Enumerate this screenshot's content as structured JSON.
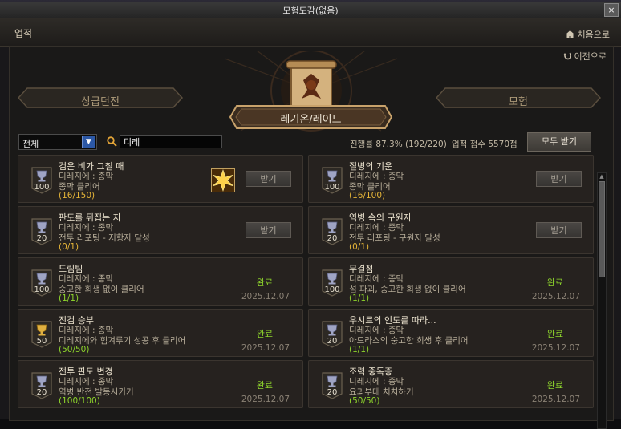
{
  "window": {
    "title": "모험도감(없음)",
    "close": "×"
  },
  "header": {
    "title": "업적",
    "home_label": "처음으로",
    "back_label": "이전으로"
  },
  "categories": {
    "left": "상급던전",
    "center": "레기온/레이드",
    "right": "모험"
  },
  "filter": {
    "selected": "전체",
    "search_value": "디레"
  },
  "summary": {
    "progress": "진행률 87.3% (192/220)",
    "score": "업적 점수  5570점",
    "claim_all": "모두 받기"
  },
  "colors": {
    "complete_green": "#8ed52c",
    "progress_green": "#8ed52c",
    "progress_yellow": "#e3b338",
    "accent_blue": "#2c58a6"
  },
  "achievements": [
    {
      "title": "검은 비가 그칠 때",
      "sub": "디레지에 : 종막",
      "desc": "종막 클리어",
      "progress": "(16/150)",
      "points": "100",
      "badge": "silver",
      "claim": "받기",
      "status": "",
      "date": "",
      "reward_icon": "star-burst-icon"
    },
    {
      "title": "질병의 기운",
      "sub": "디레지에 : 종막",
      "desc": "종막 클리어",
      "progress": "(16/100)",
      "points": "100",
      "badge": "silver",
      "claim": "받기",
      "status": "",
      "date": ""
    },
    {
      "title": "판도를 뒤집는 자",
      "sub": "디레지에 : 종막",
      "desc": "전투 리포팅 - 저항자 달성",
      "progress": "(0/1)",
      "points": "20",
      "badge": "silver",
      "claim": "받기",
      "status": "",
      "date": ""
    },
    {
      "title": "역병 속의 구원자",
      "sub": "디레지에 : 종막",
      "desc": "전투 리포팅 - 구원자 달성",
      "progress": "(0/1)",
      "points": "20",
      "badge": "silver",
      "claim": "받기",
      "status": "",
      "date": ""
    },
    {
      "title": "드림팀",
      "sub": "디레지에 : 종막",
      "desc": "숭고한 희생 없이 클리어",
      "progress": "(1/1)",
      "points": "100",
      "badge": "silver",
      "claim": "",
      "status": "완료",
      "date": "2025.12.07"
    },
    {
      "title": "무결점",
      "sub": "디레지에 : 종막",
      "desc": "섬 파괴, 숭고한 희생 없이 클리어",
      "progress": "(1/1)",
      "points": "100",
      "badge": "silver",
      "claim": "",
      "status": "완료",
      "date": "2025.12.07"
    },
    {
      "title": "진검 승부",
      "sub": "디레지에 : 종막",
      "desc": "디레지에와 힘겨루기 성공 후 클리어",
      "progress": "(50/50)",
      "points": "50",
      "badge": "gold",
      "claim": "",
      "status": "완료",
      "date": "2025.12.07"
    },
    {
      "title": "우시르의 인도를 따라...",
      "sub": "디레지에 : 종막",
      "desc": "아드라스의 숭고한 희생 후 클리어",
      "progress": "(1/1)",
      "points": "20",
      "badge": "silver",
      "claim": "",
      "status": "완료",
      "date": "2025.12.07"
    },
    {
      "title": "전투 판도 변경",
      "sub": "디레지에 : 종막",
      "desc": "역병 반전 발동시키기",
      "progress": "(100/100)",
      "points": "20",
      "badge": "silver",
      "claim": "",
      "status": "완료",
      "date": "2025.12.07"
    },
    {
      "title": "조력 중독증",
      "sub": "디레지에 : 종막",
      "desc": "요괴부대 처치하기",
      "progress": "(50/50)",
      "points": "20",
      "badge": "silver",
      "claim": "",
      "status": "완료",
      "date": "2025.12.07"
    }
  ]
}
